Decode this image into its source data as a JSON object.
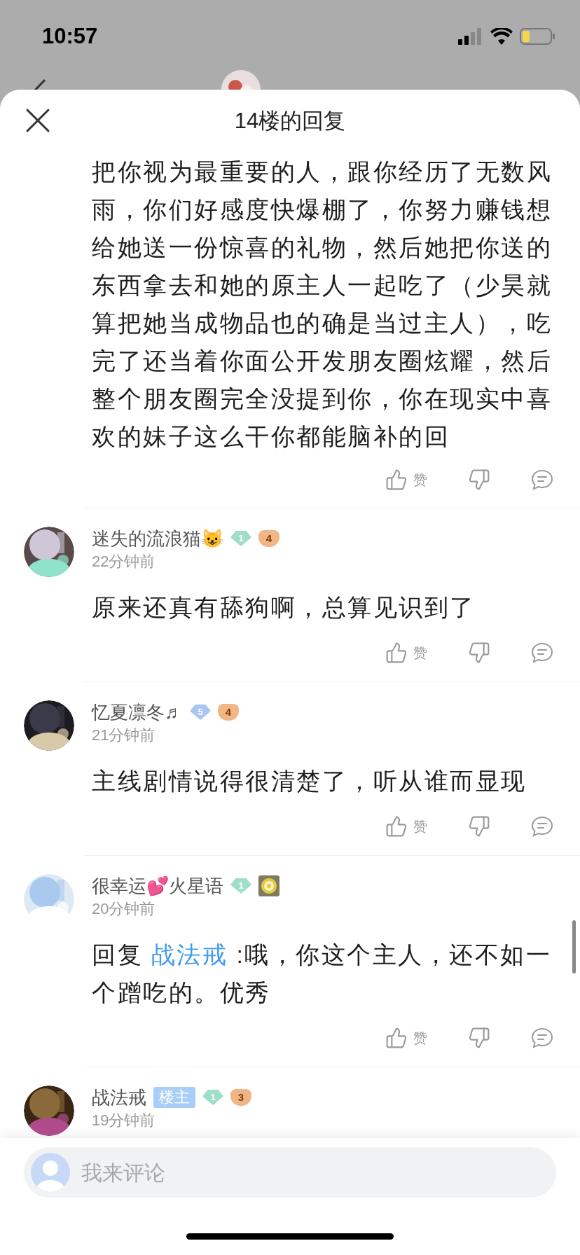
{
  "status_bar": {
    "time": "10:57"
  },
  "sheet": {
    "title": "14楼的回复"
  },
  "main_post": {
    "text": "把你视为最重要的人，跟你经历了无数风雨，你们好感度快爆棚了，你努力赚钱想给她送一份惊喜的礼物，然后她把你送的东西拿去和她的原主人一起吃了（少昊就算把她当成物品也的确是当过主人），吃完了还当着你面公开发朋友圈炫耀，然后整个朋友圈完全没提到你，你在现实中喜欢的妹子这么干你都能脑补的回",
    "like_label": "赞"
  },
  "comments": [
    {
      "name": "迷失的流浪猫😺",
      "badges": [
        {
          "kind": "diamond",
          "label": "1",
          "color": "#9fdfc9"
        },
        {
          "kind": "pad",
          "label": "4"
        }
      ],
      "time": "22分钟前",
      "body": [
        {
          "kind": "text",
          "text": "原来还真有舔狗啊，总算见识到了"
        }
      ],
      "like_label": "赞"
    },
    {
      "name": "忆夏凛冬♬",
      "badges": [
        {
          "kind": "diamond",
          "label": "5",
          "color": "#a9c6f3"
        },
        {
          "kind": "pad",
          "label": "4"
        }
      ],
      "time": "21分钟前",
      "body": [
        {
          "kind": "text",
          "text": "主线剧情说得很清楚了，听从谁而显现"
        }
      ],
      "like_label": "赞"
    },
    {
      "name": "很幸运💕火星语",
      "badges": [
        {
          "kind": "diamond",
          "label": "1",
          "color": "#9fdfc9"
        },
        {
          "kind": "medal"
        }
      ],
      "time": "20分钟前",
      "body": [
        {
          "kind": "text",
          "text": "回复"
        },
        {
          "kind": "link",
          "text": "战法戒"
        },
        {
          "kind": "text",
          "text": ":哦，你这个主人，还不如一个蹭吃的。优秀"
        }
      ],
      "like_label": "赞"
    },
    {
      "name": "战法戒",
      "badges": [
        {
          "kind": "tag",
          "label": "楼主"
        },
        {
          "kind": "diamond",
          "label": "1",
          "color": "#9fdfc9"
        },
        {
          "kind": "pad",
          "label": "3"
        }
      ],
      "time": "19分钟前"
    }
  ],
  "composer": {
    "placeholder": "我来评论"
  }
}
